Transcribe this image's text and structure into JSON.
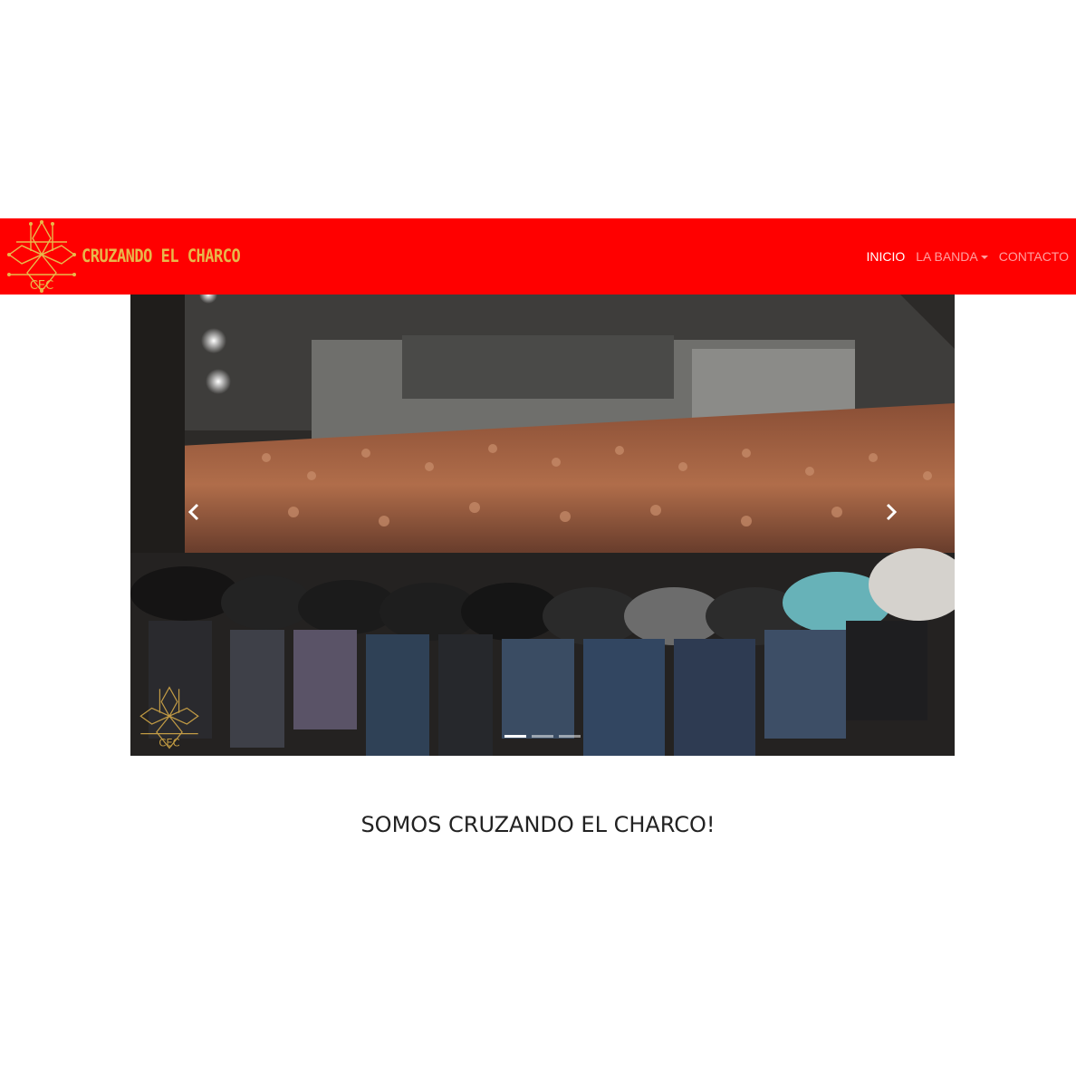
{
  "brand": {
    "name": "CRUZANDO EL CHARCO",
    "logo_text": "CEC"
  },
  "nav": {
    "items": [
      {
        "label": "INICIO",
        "active": true
      },
      {
        "label": "LA BANDA",
        "dropdown": true
      },
      {
        "label": "CONTACTO"
      }
    ]
  },
  "carousel": {
    "slide_count": 3,
    "active_slide": 1,
    "watermark_text": "CEC",
    "prev_icon": "chevron-left-icon",
    "next_icon": "chevron-right-icon"
  },
  "main": {
    "heading": "SOMOS CRUZANDO EL CHARCO!"
  },
  "colors": {
    "navbar": "#ff0000",
    "brand": "#e8b84b",
    "nav_active": "#ffffff"
  }
}
